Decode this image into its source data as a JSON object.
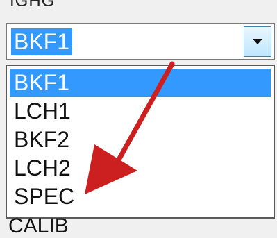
{
  "top_label": "IGHG",
  "combo": {
    "value": "BKF1"
  },
  "dropdown": {
    "options": [
      "BKF1",
      "LCH1",
      "BKF2",
      "LCH2",
      "SPEC"
    ],
    "selected_index": 0,
    "cutoff_option": "CALIB"
  },
  "colors": {
    "selection": "#3399ff",
    "annotation_arrow": "#cc1f1f"
  }
}
